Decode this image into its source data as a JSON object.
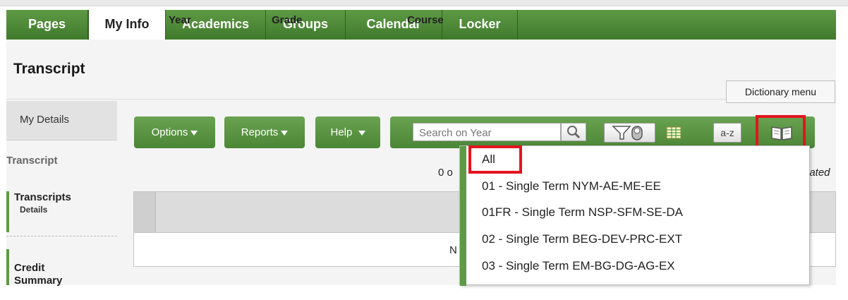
{
  "tabs": [
    {
      "label": "Pages",
      "active": false
    },
    {
      "label": "My Info",
      "active": true
    },
    {
      "label": "Academics",
      "active": false
    },
    {
      "label": "Groups",
      "active": false
    },
    {
      "label": "Calendar",
      "active": false
    },
    {
      "label": "Locker",
      "active": false
    }
  ],
  "page": {
    "title": "Transcript"
  },
  "tooltip": "Dictionary menu",
  "sidebar": {
    "top_item": "My Details",
    "section": "Transcript",
    "items": [
      {
        "label": "Transcripts",
        "sub": "Details"
      },
      {
        "label": "Credit\nSummary",
        "sub": ""
      }
    ]
  },
  "buttons": {
    "options": "Options",
    "reports": "Reports",
    "help": "Help"
  },
  "search": {
    "placeholder": "Search on Year"
  },
  "toolbar_icons": [
    "search-icon",
    "filter-icon",
    "grid-icon",
    "sort-az-icon",
    "dictionary-book-icon"
  ],
  "toolbar": {
    "sort_label": "a-z"
  },
  "results": {
    "count_text": "0 o",
    "updated_text": "lated"
  },
  "table": {
    "columns": [
      "Year",
      "Grade",
      "Course"
    ],
    "empty_text": "N"
  },
  "dictionary_menu": {
    "items": [
      "All",
      "01 - Single Term NYM-AE-ME-EE",
      "01FR - Single Term NSP-SFM-SE-DA",
      "02 - Single Term BEG-DEV-PRC-EXT",
      "03 - Single Term EM-BG-DG-AG-EX"
    ],
    "highlighted": "All"
  },
  "colors": {
    "tab_green": "#4f8a38",
    "highlight_red": "#e3151f",
    "background": "#f4f4f4"
  }
}
